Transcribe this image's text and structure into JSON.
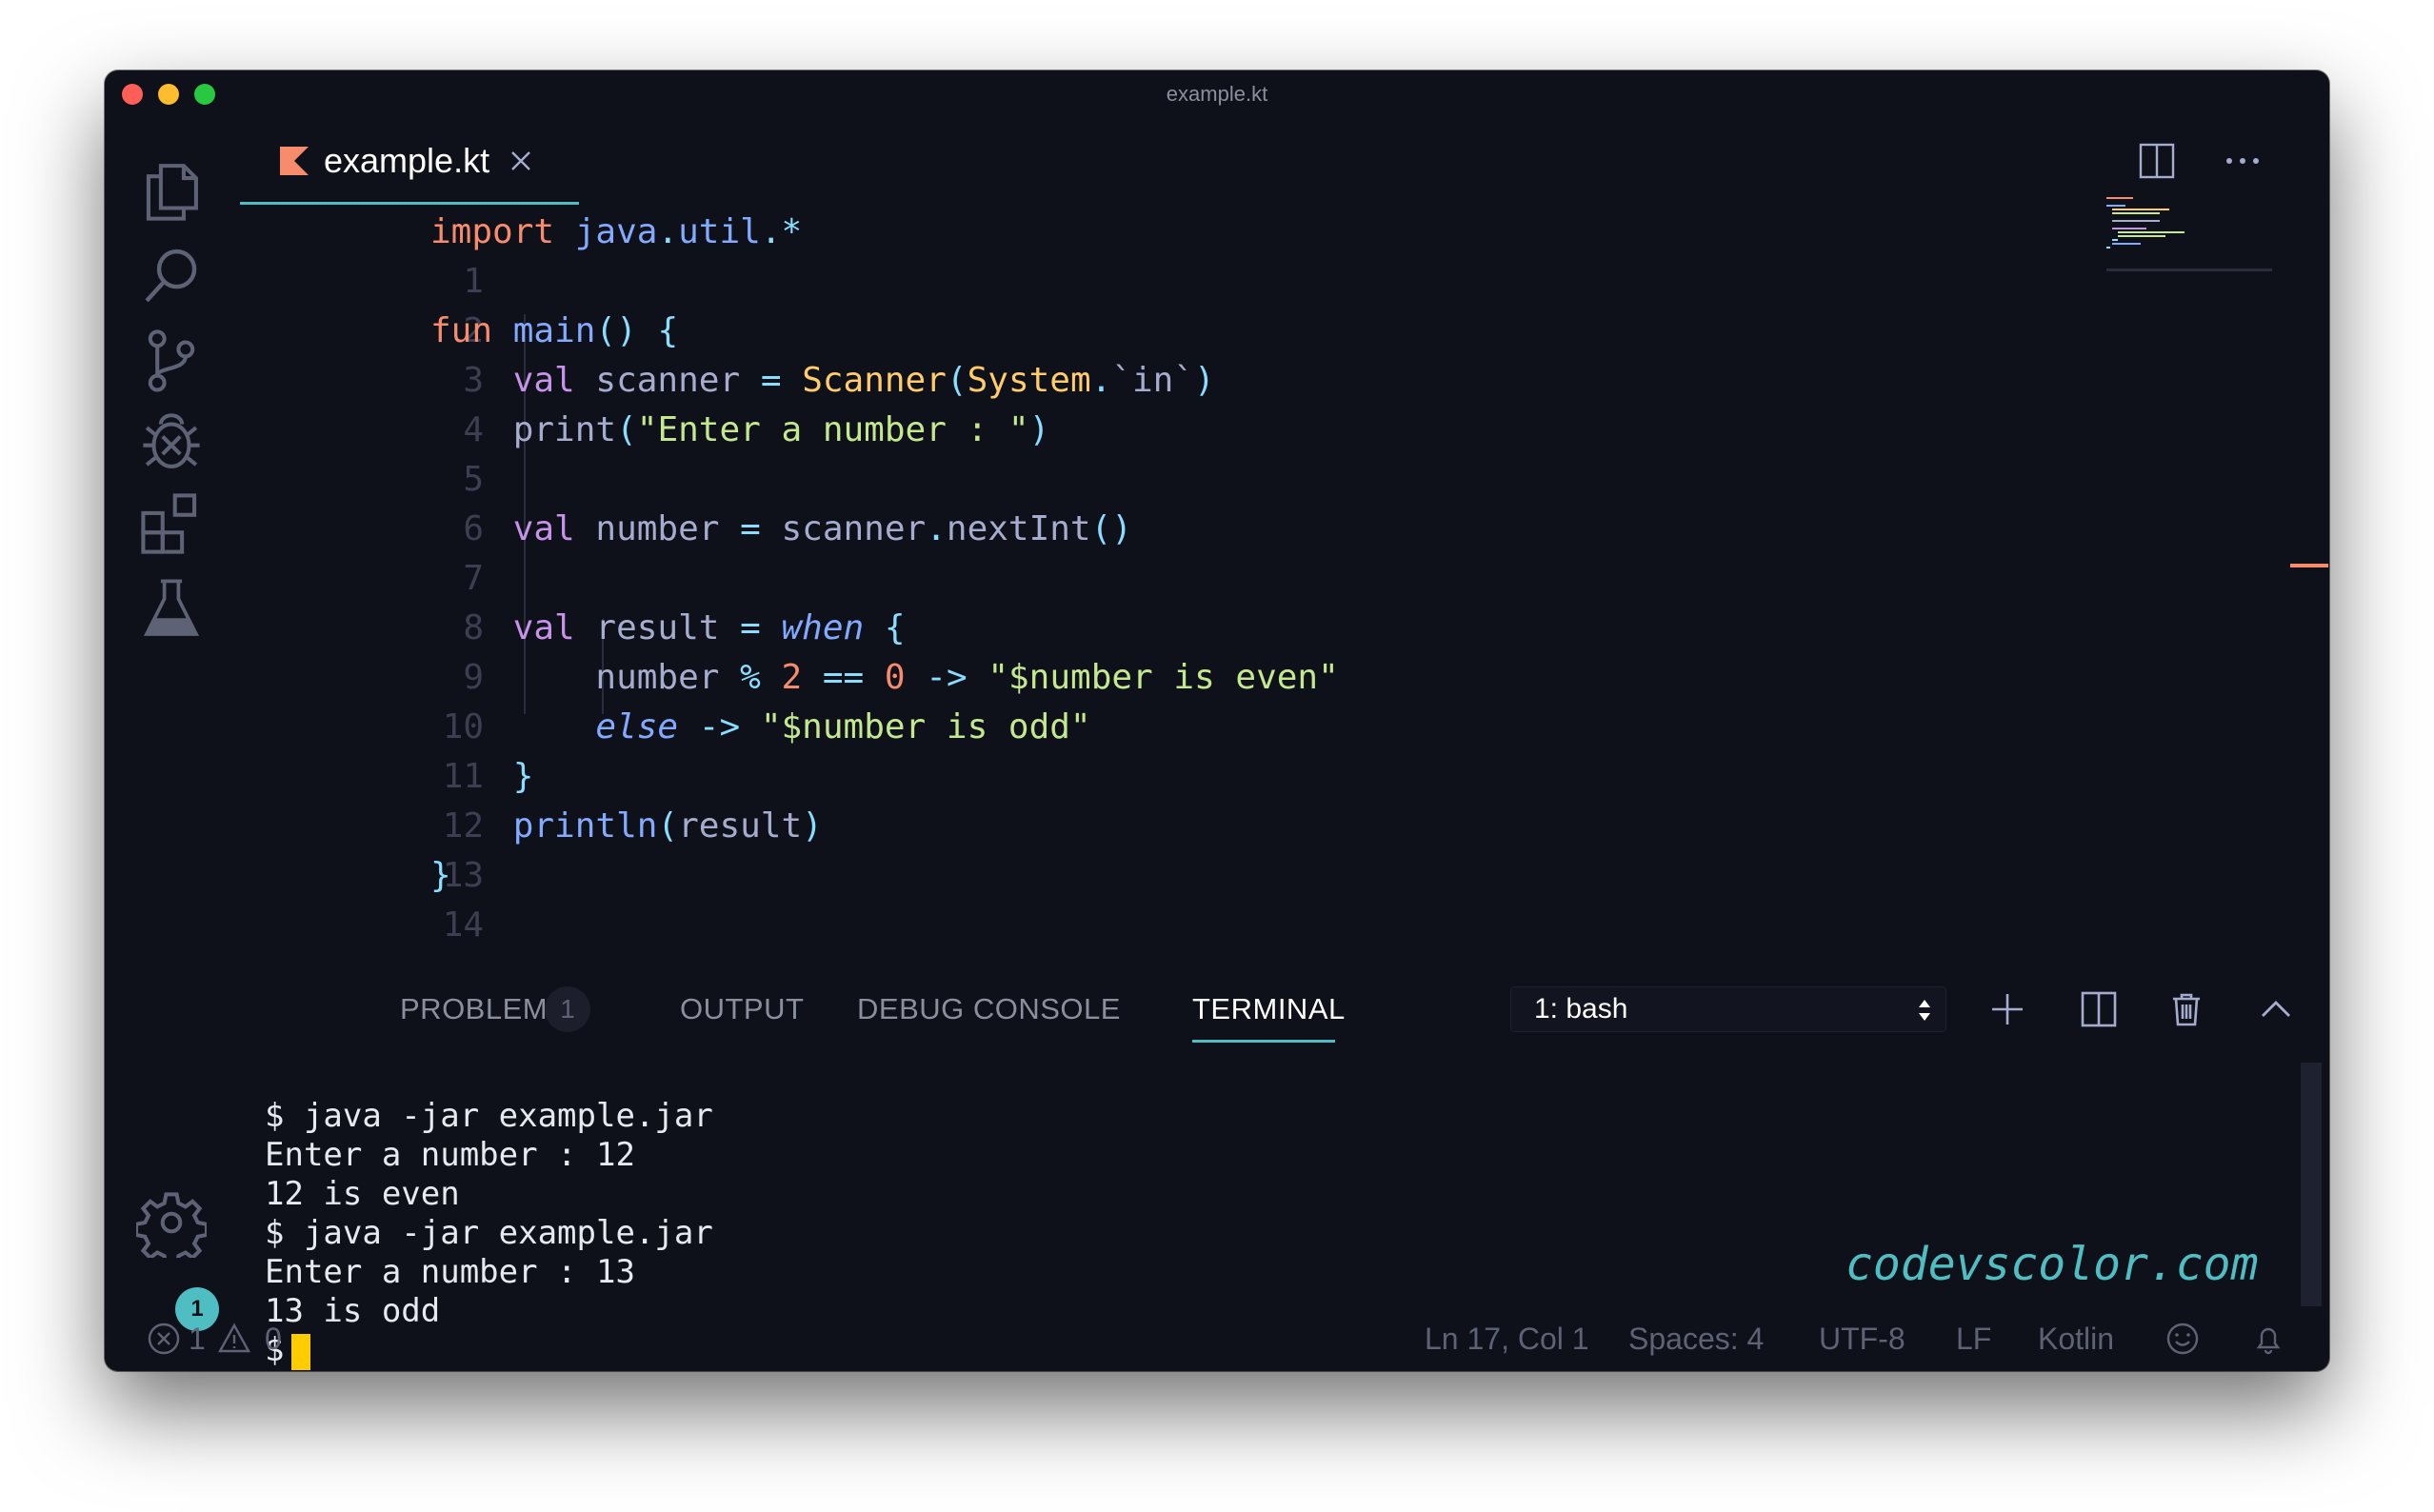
{
  "window": {
    "title": "example.kt"
  },
  "tab": {
    "label": "example.kt"
  },
  "editor": {
    "line_numbers": [
      "1",
      "2",
      "3",
      "4",
      "5",
      "6",
      "7",
      "8",
      "9",
      "10",
      "11",
      "12",
      "13",
      "14"
    ]
  },
  "panel": {
    "tabs": {
      "problems": "PROBLEMS",
      "output": "OUTPUT",
      "debug_console": "DEBUG CONSOLE",
      "terminal": "TERMINAL"
    },
    "problems_count": "1",
    "terminal_selector": "1: bash"
  },
  "terminal": {
    "lines": [
      "$ java -jar example.jar",
      "Enter a number : 12",
      "12 is even",
      "$ java -jar example.jar",
      "Enter a number : 13",
      "13 is odd",
      "$"
    ]
  },
  "watermark": "codevscolor.com",
  "settings_badge": "1",
  "statusbar": {
    "errors": "1",
    "warnings": "0",
    "position": "Ln 17, Col 1",
    "spaces": "Spaces: 4",
    "encoding": "UTF-8",
    "eol": "LF",
    "language": "Kotlin"
  },
  "colors": {
    "background": "#0f111a",
    "accent": "#4fbec2",
    "keyword": "#f78c6c",
    "function": "#82aaff",
    "modifier": "#c792ea",
    "type": "#ffcb6b",
    "string": "#c3e88d",
    "operator": "#89ddff",
    "cursor": "#ffcc00"
  }
}
